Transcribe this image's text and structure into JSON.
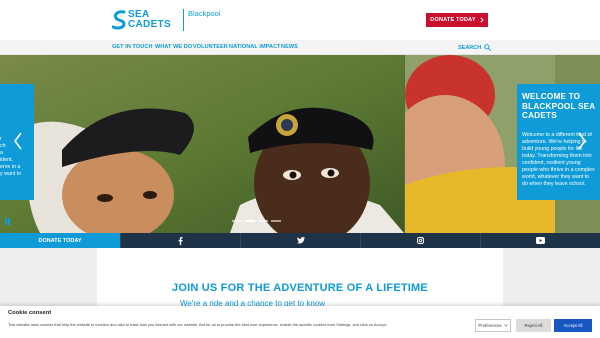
{
  "header": {
    "logo_line1": "SEA",
    "logo_line2": "CADETS",
    "unit_name": "Blackpool",
    "donate_label": "DONATE TODAY",
    "brand_color": "#0f9bd7",
    "donate_color": "#c8102e"
  },
  "nav": {
    "items": [
      {
        "label": "GET IN TOUCH"
      },
      {
        "label": "WHAT WE DO"
      },
      {
        "label": "VOLUNTEER"
      },
      {
        "label": "NATIONAL IMPACT"
      },
      {
        "label": "NEWS"
      }
    ],
    "search_label": "SEARCH",
    "search_icon": "search-icon"
  },
  "hero": {
    "prev_fragment": [
      "r",
      "ch",
      "a",
      "ident,",
      "erve in a",
      "y want to"
    ],
    "next_title": "WELCOME TO BLACKPOOL SEA CADETS",
    "next_body": "Welcome to a different kind of adventure. We're helping to build young people for life today. Transforming them into confident, resilient young people who thrive in a complex world, whatever they want to do when they leave school.",
    "slides_count": 4,
    "active_slide": 1
  },
  "social_bar": {
    "donate_label": "DONATE TODAY",
    "icons": [
      "facebook-icon",
      "twitter-icon",
      "instagram-icon",
      "youtube-icon"
    ]
  },
  "main": {
    "headline": "JOIN US FOR THE ADVENTURE OF A LIFETIME",
    "subline": "We're a ride and a chance to get to know"
  },
  "cookie": {
    "title": "Cookie consent",
    "text": "This website uses cookies that help the website to function and also to track how you interact with our website. But for us to provide the best user experience, enable the specific cookies from Settings, and click on Accept.",
    "preferences_label": "Preferences",
    "reject_label": "Reject All",
    "accept_label": "Accept All"
  }
}
